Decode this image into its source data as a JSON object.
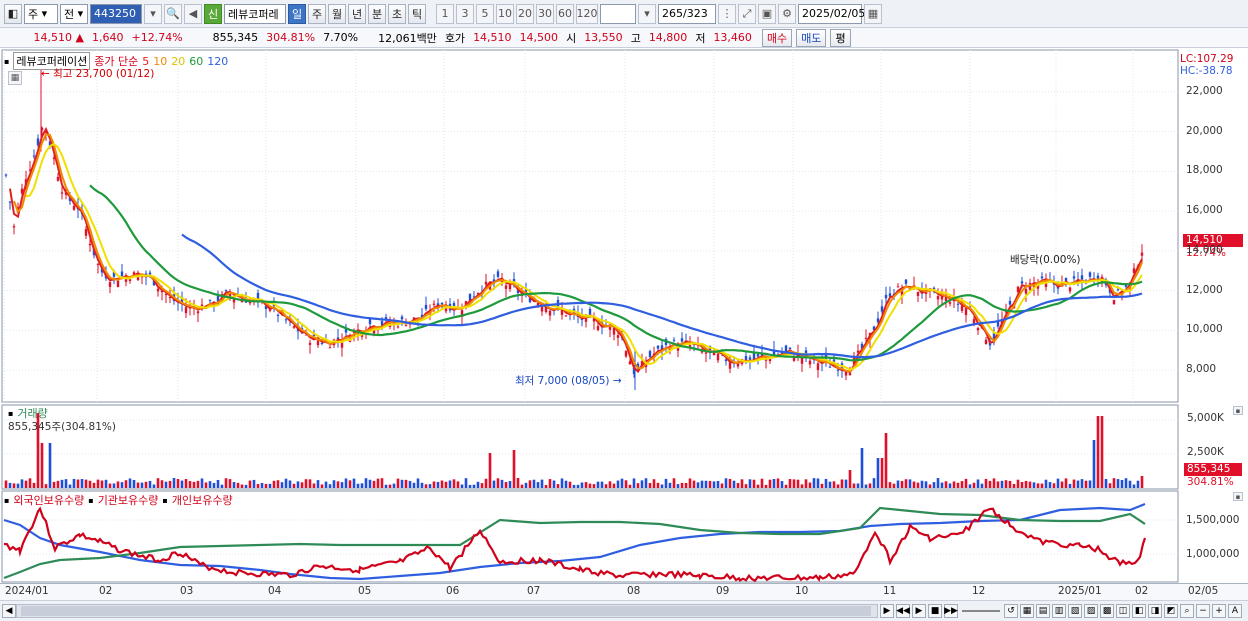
{
  "toolbar": {
    "market_label": "주",
    "prev_label": "전",
    "code_value": "443250",
    "new_badge": "신",
    "stock_name": "레뷰코퍼레",
    "periods": [
      "일",
      "주",
      "월",
      "년",
      "분",
      "초",
      "틱"
    ],
    "active_period": "일",
    "intervals": [
      "1",
      "3",
      "5",
      "10",
      "20",
      "30",
      "60",
      "120"
    ],
    "count_value": "265",
    "count_total": "/323",
    "date_value": "2025/02/05"
  },
  "quote": {
    "price": "14,510",
    "change": "1,640",
    "change_pct": "+12.74%",
    "volume": "855,345",
    "volume_pct": "304.81%",
    "turnover_pct": "7.70%",
    "amount": "12,061백만",
    "bid_label": "호가",
    "ask": "14,510",
    "bid": "14,500",
    "open_label": "시",
    "open": "13,550",
    "high_label": "고",
    "high": "14,800",
    "low_label": "저",
    "low": "13,460",
    "buy_label": "매수",
    "sell_label": "매도",
    "eval_label": "평"
  },
  "price_pane": {
    "title": "레뷰코퍼레이션",
    "ma_label": "종가 단순",
    "ma_periods": [
      "5",
      "10",
      "20",
      "60",
      "120"
    ],
    "ma_colors": [
      "#e02020",
      "#f08a00",
      "#f0e000",
      "#1e9a3c",
      "#2f5fe0"
    ],
    "lc_label": "LC:107.29",
    "hc_label": "HC:-38.78",
    "high_note": "최고 23,700 (01/12)",
    "low_note": "최저 7,000 (08/05)",
    "dividend_note": "배당락(0.00%)",
    "last_price_tag": "14,510",
    "last_pct_tag": "12.74%",
    "y_ticks": [
      "22,000",
      "20,000",
      "18,000",
      "16,000",
      "14,000",
      "12,000",
      "10,000",
      "8,000"
    ]
  },
  "volume_pane": {
    "title": "거래량",
    "summary": "855,345주(304.81%)",
    "y_ticks": [
      "5,000K",
      "2,500K"
    ],
    "last_tag": "855,345",
    "last_pct": "304.81%"
  },
  "holder_pane": {
    "series_labels": [
      "외국인보유수량",
      "기관보유수량",
      "개인보유수량"
    ],
    "colors": [
      "#d0021b",
      "#2f5fe0",
      "#2e8b57"
    ],
    "y_ticks": [
      "1,500,000",
      "1,000,000"
    ]
  },
  "x_axis": {
    "labels": [
      "2024/01",
      "02",
      "03",
      "04",
      "05",
      "06",
      "07",
      "08",
      "09",
      "10",
      "11",
      "12",
      "2025/01",
      "02",
      "02/05"
    ]
  },
  "chart_data": {
    "type": "candlestick",
    "title": "레뷰코퍼레이션",
    "ylabel": "",
    "ylim": [
      6500,
      23800
    ],
    "x_categories": [
      "2024/01",
      "02",
      "03",
      "04",
      "05",
      "06",
      "07",
      "08",
      "09",
      "10",
      "11",
      "12",
      "2025/01",
      "02"
    ],
    "close_approx": [
      17500,
      19500,
      14000,
      12800,
      11300,
      11200,
      9800,
      10500,
      11400,
      12200,
      11000,
      10000,
      9000,
      8600,
      8400,
      11500,
      12000,
      12500,
      12000,
      14510
    ],
    "annotations": [
      {
        "label": "최고 23,700 (01/12)",
        "value": 23700
      },
      {
        "label": "최저 7,000 (08/05)",
        "value": 7000
      },
      {
        "label": "배당락(0.00%)"
      }
    ],
    "last_close": 14510,
    "last_change_pct": 12.74
  }
}
